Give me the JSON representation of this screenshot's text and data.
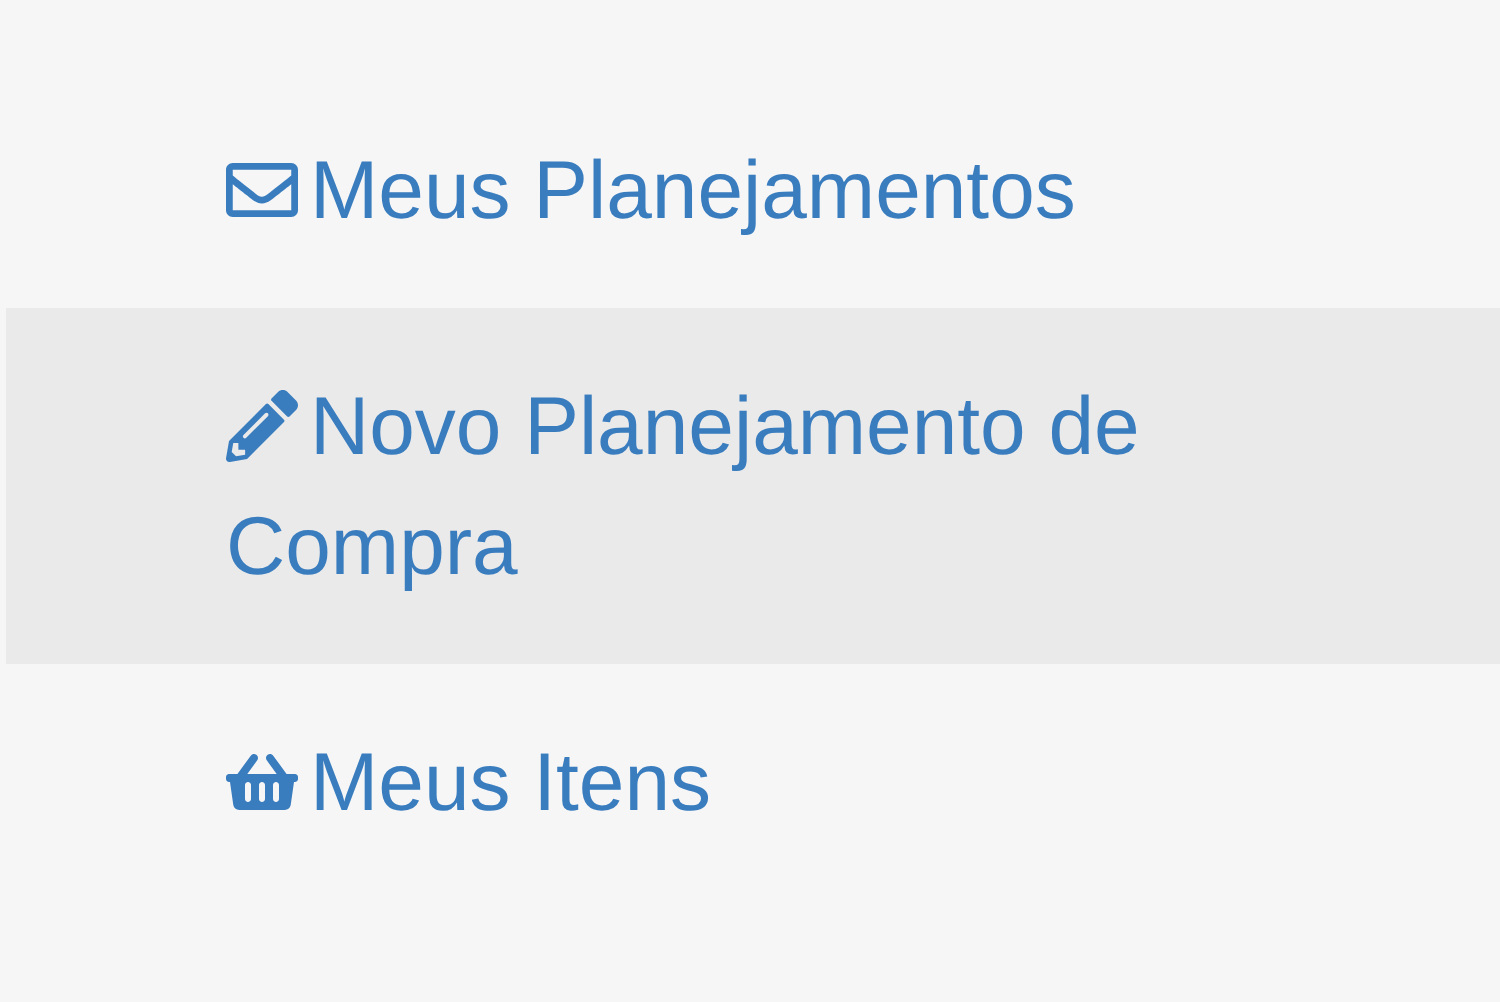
{
  "menu": [
    {
      "label": "Meus Planejamentos",
      "selected": false
    },
    {
      "label": "Novo Planejamento de Compra",
      "selected": true
    },
    {
      "label": "Meus Itens",
      "selected": false
    }
  ]
}
